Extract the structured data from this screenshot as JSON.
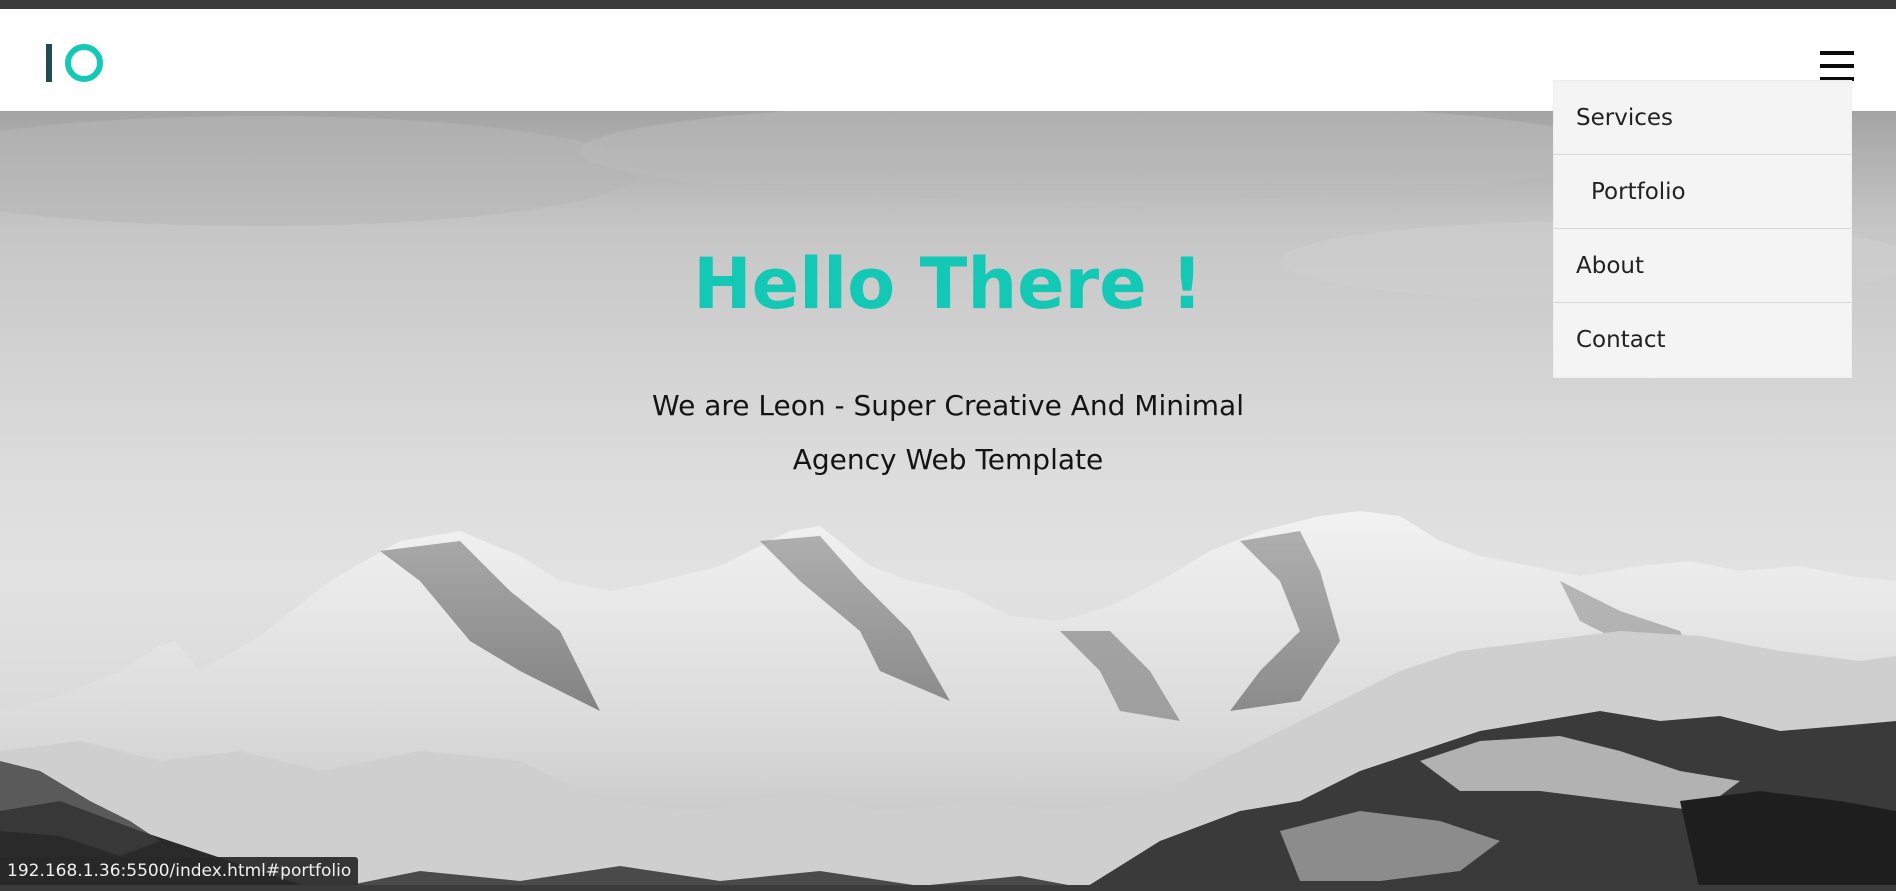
{
  "colors": {
    "accent": "#14c8b6",
    "logo_dark": "#1f4a57",
    "menu_bg": "#f4f4f4",
    "text_dark": "#141414"
  },
  "logo": {
    "icon": "io-logo-icon"
  },
  "nav": {
    "toggle_icon": "hamburger-menu-icon",
    "menu_items": [
      {
        "label": "Services"
      },
      {
        "label": "Portfolio"
      },
      {
        "label": "About"
      },
      {
        "label": "Contact"
      }
    ]
  },
  "hero": {
    "title": "Hello There !",
    "subtitle": "We are Leon - Super Creative And Minimal Agency Web Template",
    "background": "snowy-mountains-image"
  },
  "status_bar": {
    "url": "192.168.1.36:5500/index.html#portfolio"
  }
}
